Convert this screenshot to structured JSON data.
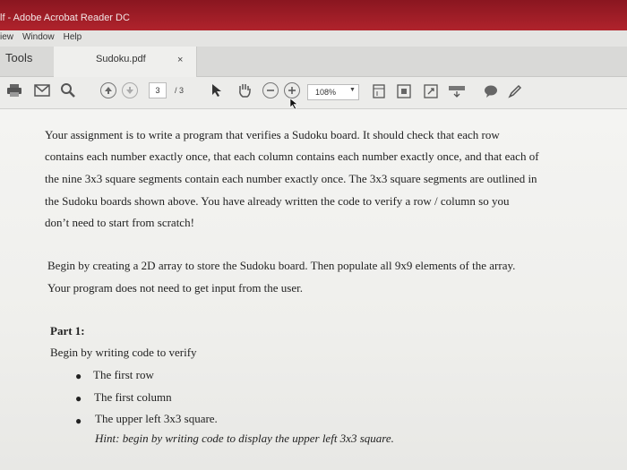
{
  "window": {
    "title": "lf - Adobe Acrobat Reader DC"
  },
  "menu": {
    "items": [
      "iew",
      "Window",
      "Help"
    ]
  },
  "tabs": {
    "tools": "Tools",
    "file": "Sudoku.pdf",
    "close": "×"
  },
  "toolbar": {
    "page_current": "3",
    "page_total": "/ 3",
    "zoom": "108%"
  },
  "document": {
    "paragraph1": [
      "Your assignment is to write a program that verifies a Sudoku board.  It should check that each row",
      "contains each number exactly once, that each column contains each number exactly once, and that each of",
      "the nine 3x3 square segments contain each number exactly once.  The 3x3 square segments are outlined in",
      "the Sudoku boards shown above.  You have already written the code to verify a row / column so you",
      "don’t need to start from scratch!"
    ],
    "paragraph2": [
      "Begin by creating a 2D array to store the Sudoku board.  Then populate all 9x9 elements of the array.",
      "Your program does not need to get input from the user."
    ],
    "part_heading": "Part 1:",
    "part_intro": "Begin by writing code to verify",
    "bullets": [
      "The first row",
      "The first column",
      "The upper left 3x3 square."
    ],
    "hint": "Hint: begin by writing code to display the upper left 3x3 square."
  }
}
